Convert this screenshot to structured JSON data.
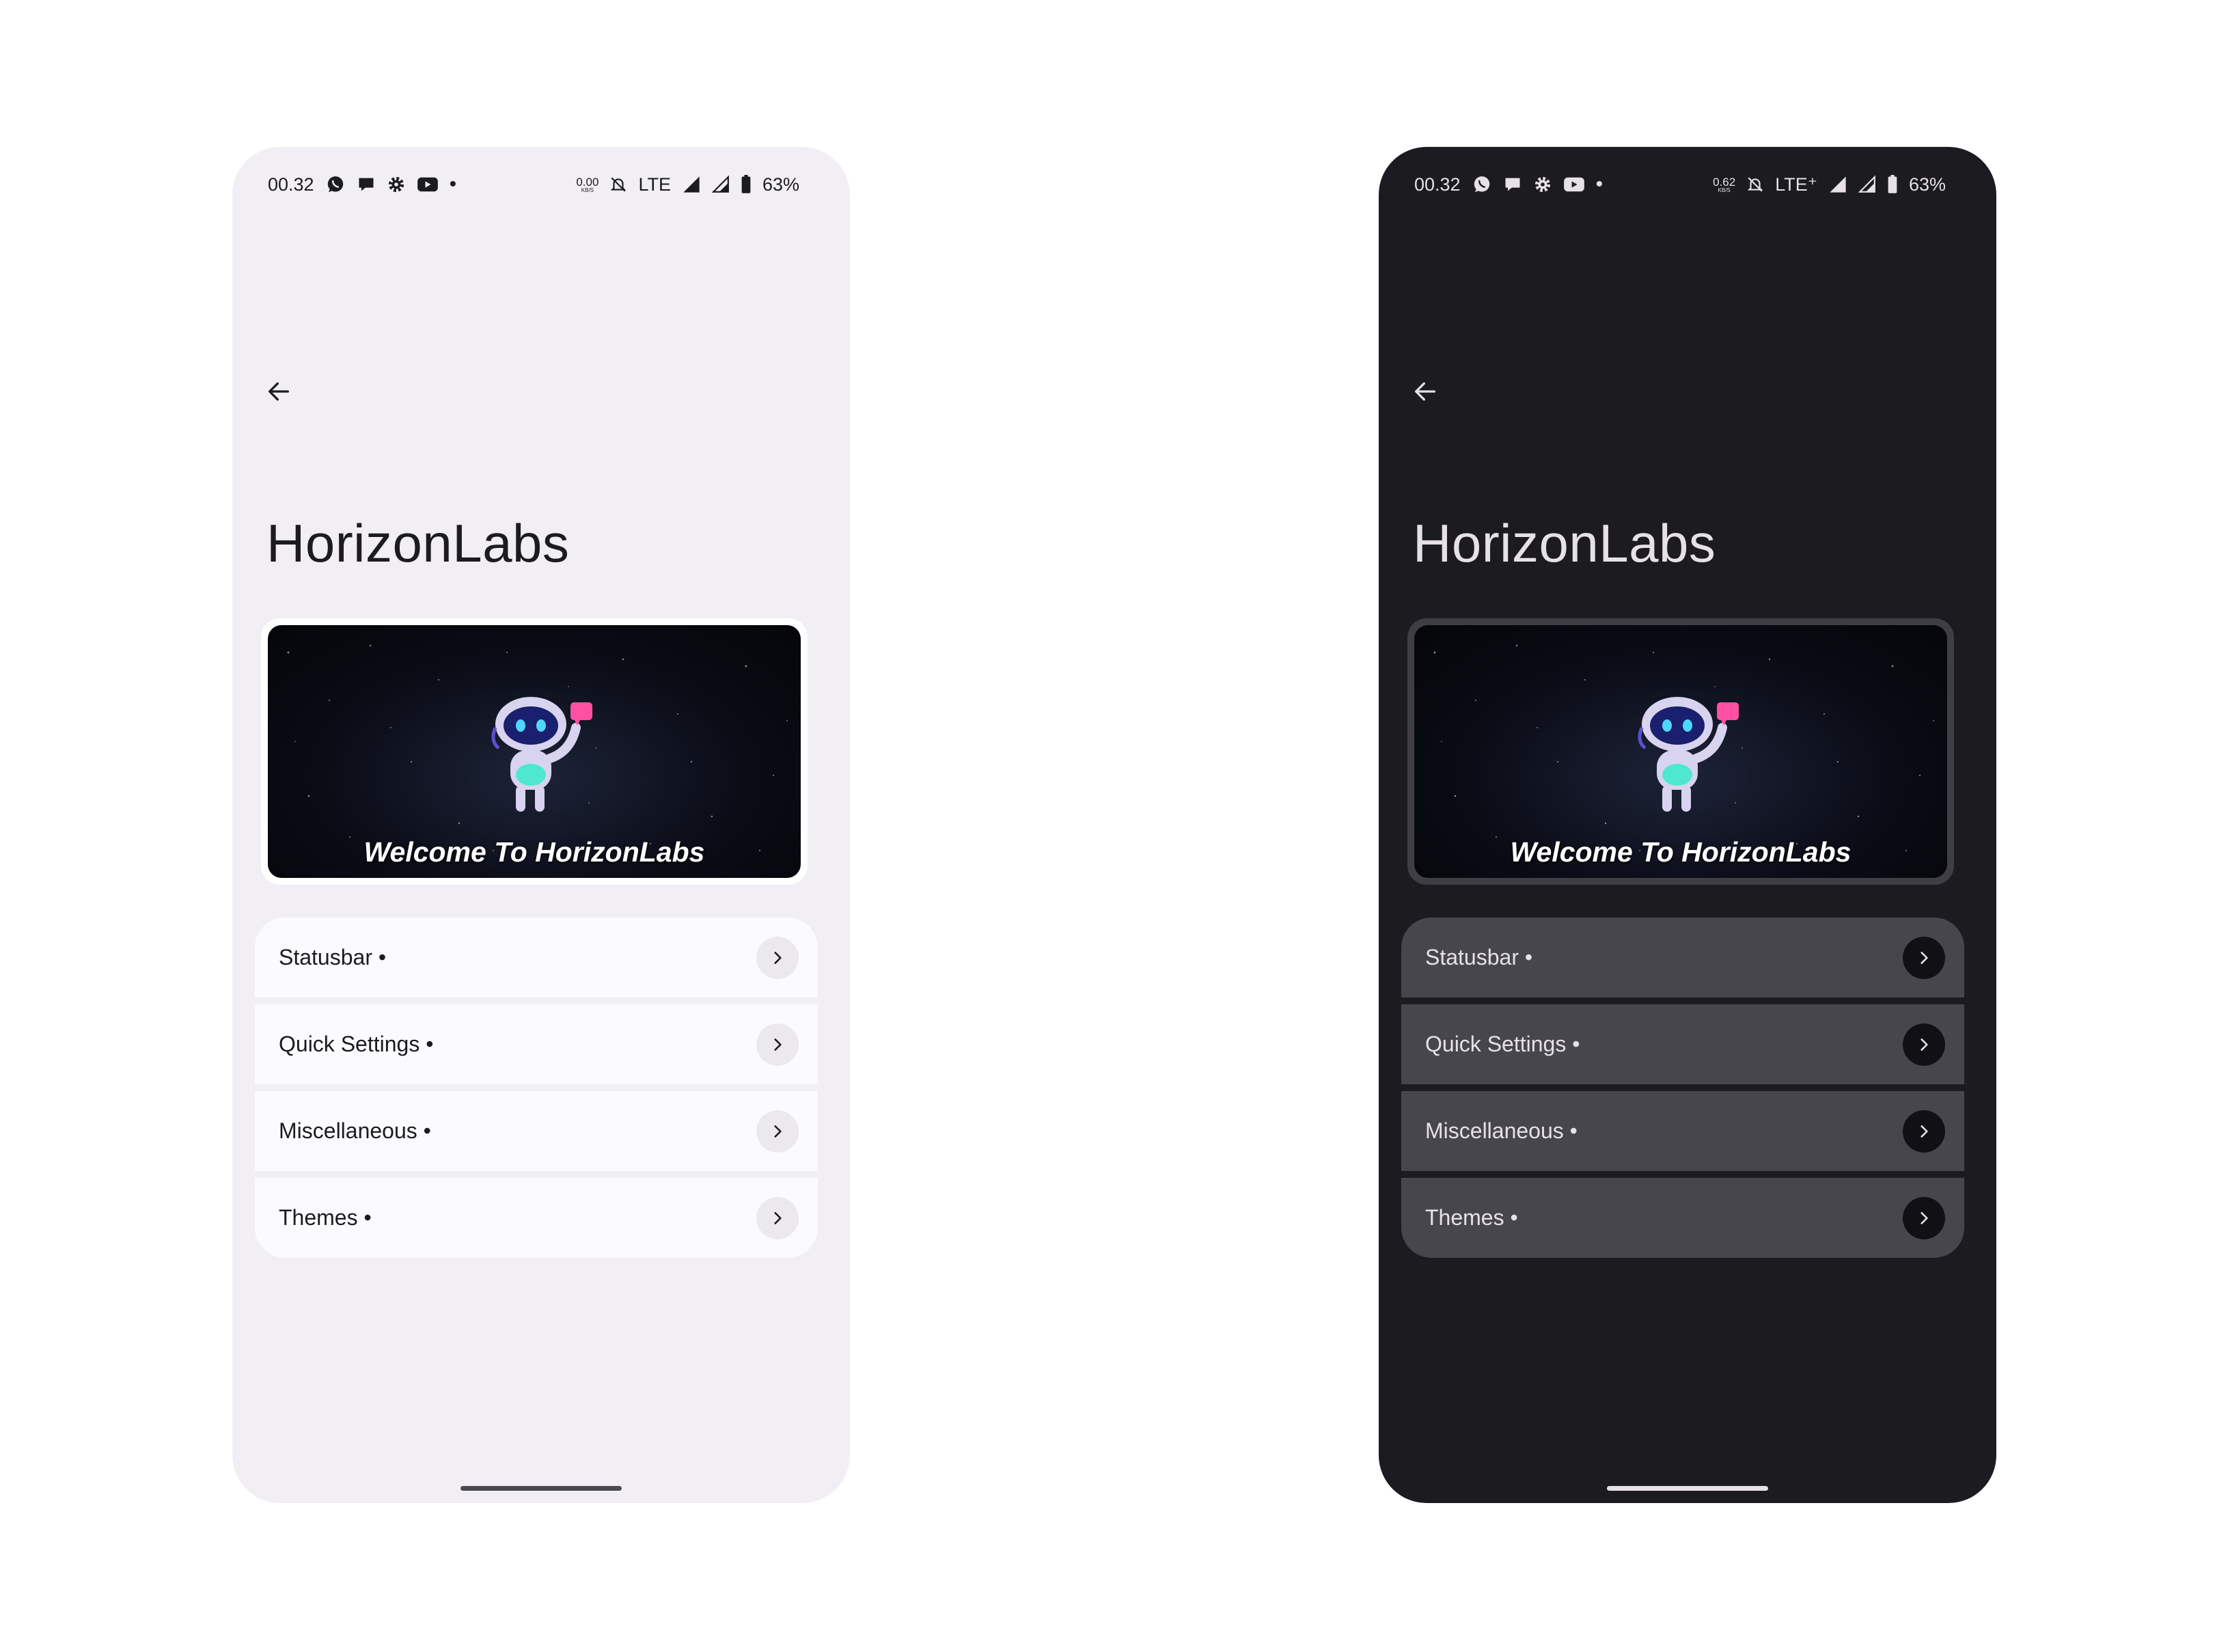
{
  "screens": [
    {
      "theme": "light",
      "status_bar": {
        "time": "00.32",
        "left_icons": [
          "whatsapp-icon",
          "chat-bubble-icon",
          "settings-gear-icon",
          "youtube-icon"
        ],
        "dot": "•",
        "net_speed_value": "0.00",
        "net_speed_unit": "KB/S",
        "network": "LTE",
        "battery": "63%"
      },
      "title": "HorizonLabs",
      "banner": {
        "caption": "Welcome To HorizonLabs"
      },
      "menu": [
        {
          "label": "Statusbar •"
        },
        {
          "label": "Quick Settings •"
        },
        {
          "label": "Miscellaneous •"
        },
        {
          "label": "Themes •"
        }
      ]
    },
    {
      "theme": "dark",
      "status_bar": {
        "time": "00.32",
        "left_icons": [
          "whatsapp-icon",
          "chat-bubble-icon",
          "settings-gear-icon",
          "youtube-icon"
        ],
        "dot": "•",
        "net_speed_value": "0.62",
        "net_speed_unit": "KB/S",
        "network": "LTE⁺",
        "battery": "63%"
      },
      "title": "HorizonLabs",
      "banner": {
        "caption": "Welcome To HorizonLabs"
      },
      "menu": [
        {
          "label": "Statusbar •"
        },
        {
          "label": "Quick Settings •"
        },
        {
          "label": "Miscellaneous •"
        },
        {
          "label": "Themes •"
        }
      ]
    }
  ],
  "colors": {
    "light_bg": "#f1eff4",
    "light_card": "#fbfbfd",
    "dark_bg": "#1c1b1f",
    "dark_card": "#47464d",
    "mascot_accent": "#ff4fa3",
    "mascot_glow": "#4ee8d0"
  }
}
